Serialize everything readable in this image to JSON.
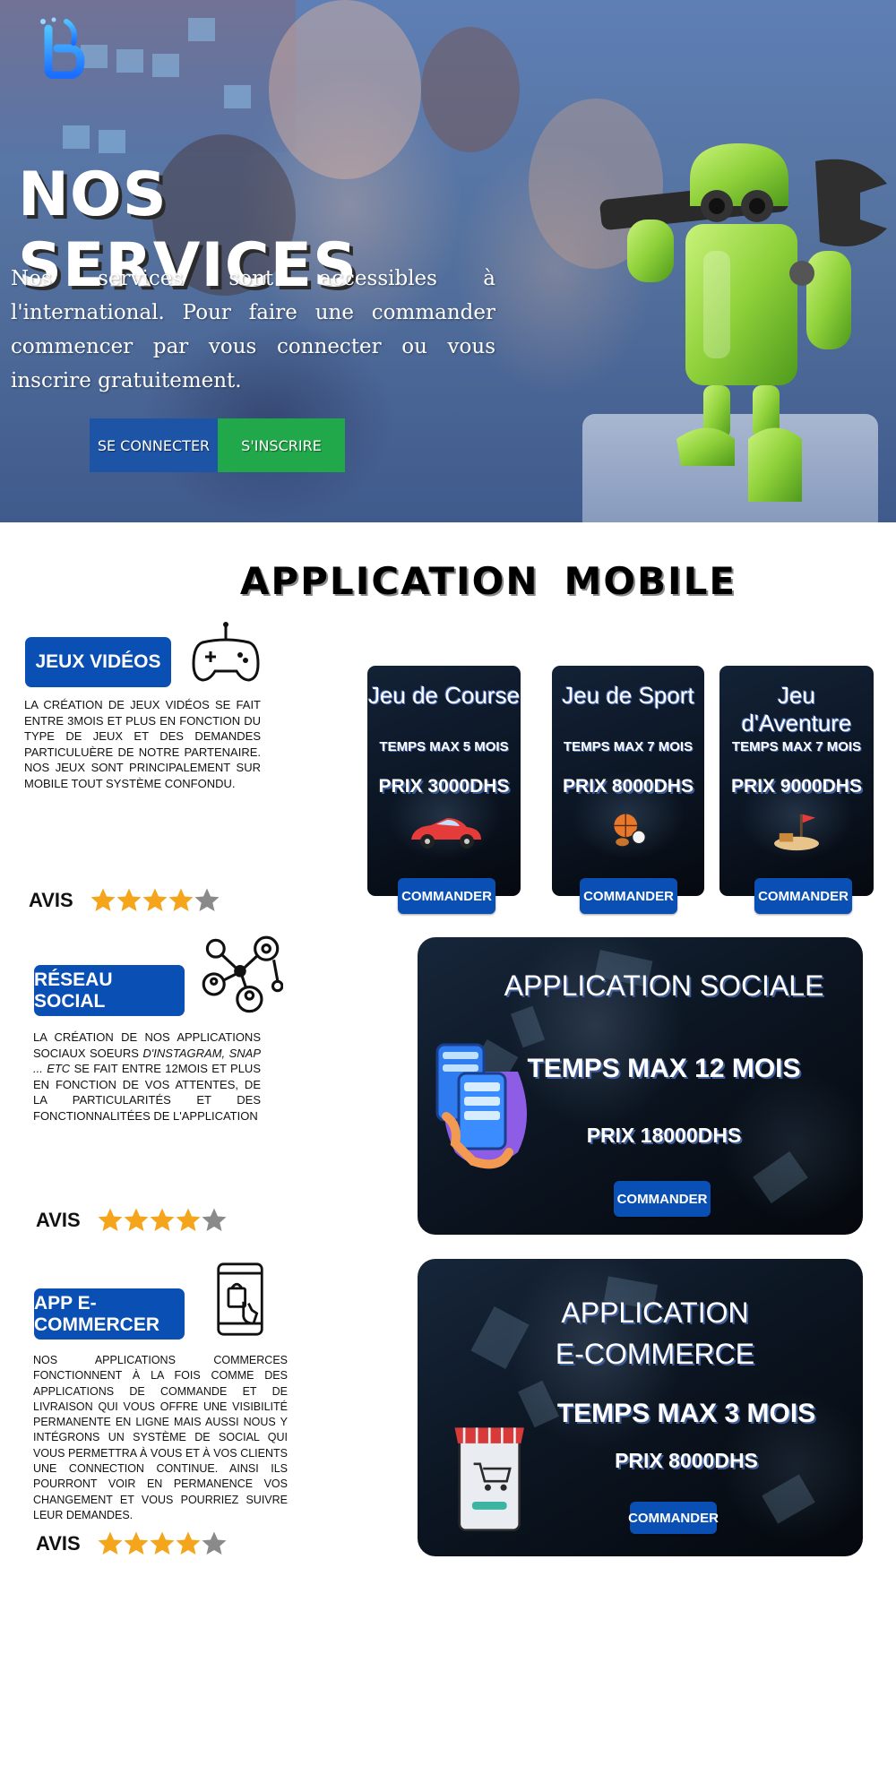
{
  "hero": {
    "title": "NOS SERVICES",
    "text": "Nos services sont accessibles à l'international. Pour faire une commander commencer par vous connecter ou vous inscrire gratuitement.",
    "login_label": "SE CONNECTER",
    "signup_label": "S'INSCRIRE"
  },
  "section": {
    "title_part1": "APPLICATION",
    "title_part2": "MOBILE"
  },
  "services": [
    {
      "label": "JEUX VIDÉOS",
      "description": "LA CRÉATION DE JEUX VIDÉOS SE FAIT ENTRE 3MOIS ET PLUS EN FONCTION DU TYPE DE JEUX ET DES DEMANDES PARTICULUÈRE DE NOTRE PARTENAIRE. NOS JEUX SONT PRINCIPALEMENT SUR MOBILE TOUT SYSTÈME CONFONDU.",
      "avis_label": "AVIS",
      "rating": 4,
      "rating_max": 5,
      "icon": "gamepad-icon"
    },
    {
      "label": "RÉSEAU SOCIAL",
      "description_part1": "LA CRÉATION DE NOS APPLICATIONS SOCIAUX SOEURS ",
      "description_italic": "D'INSTAGRAM, SNAP ... ETC",
      "description_part2": " SE FAIT ENTRE 12MOIS ET PLUS EN FONCTION DE VOS ATTENTES, DE LA PARTICULARITÉS ET DES FONCTIONNALITÉES DE L'APPLICATION",
      "avis_label": "AVIS",
      "rating": 4,
      "rating_max": 5,
      "icon": "social-network-icon"
    },
    {
      "label": "APP E-COMMERCER",
      "description": "NOS APPLICATIONS COMMERCES FONCTIONNENT À LA FOIS COMME DES APPLICATIONS DE COMMANDE ET DE LIVRAISON QUI VOUS OFFRE UNE VISIBILITÉ PERMANENTE EN LIGNE MAIS AUSSI NOUS Y INTÉGRONS UN SYSTÈME DE SOCIAL QUI VOUS PERMETTRA À VOUS ET À VOS CLIENTS UNE CONNECTION CONTINUE. AINSI ILS POURRONT VOIR EN PERMANENCE VOS CHANGEMENT ET VOUS POURRIEZ SUIVRE LEUR DEMANDES.",
      "avis_label": "AVIS",
      "rating": 4,
      "rating_max": 5,
      "icon": "shopping-phone-icon"
    }
  ],
  "game_cards": [
    {
      "title": "Jeu de Course",
      "time": "TEMPS MAX 5 MOIS",
      "price": "PRIX 3000DHS",
      "button": "COMMANDER",
      "art": "race-car-icon"
    },
    {
      "title": "Jeu de Sport",
      "time": "TEMPS MAX 7 MOIS",
      "price": "PRIX 8000DHS",
      "button": "COMMANDER",
      "art": "sports-balls-icon"
    },
    {
      "title": "Jeu d'Aventure",
      "time": "TEMPS MAX 7 MOIS",
      "price": "PRIX 9000DHS",
      "button": "COMMANDER",
      "art": "treasure-island-icon"
    }
  ],
  "social_card": {
    "title": "APPLICATION SOCIALE",
    "time": "TEMPS MAX 12 MOIS",
    "price": "PRIX 18000DHS",
    "button": "COMMANDER"
  },
  "ecommerce_card": {
    "title_line1": "APPLICATION",
    "title_line2": "E-COMMERCE",
    "time": "TEMPS MAX 3 MOIS",
    "price": "PRIX 8000DHS",
    "button": "COMMANDER"
  },
  "colors": {
    "primary_blue": "#0a4fb3",
    "signup_green": "#21a84a",
    "android_green": "#8fd13a",
    "star_gold": "#f4a51c",
    "star_gray": "#8a8a8a"
  }
}
